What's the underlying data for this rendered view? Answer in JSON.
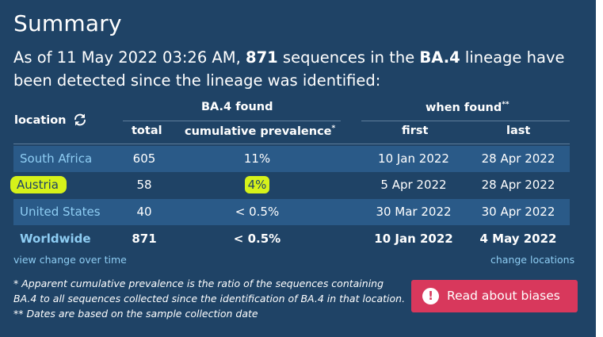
{
  "summary": {
    "title": "Summary",
    "intro_prefix": "As of 11 May 2022 03:26 AM, ",
    "sequence_count": "871",
    "intro_middle": " sequences in the ",
    "lineage": "BA.4",
    "intro_suffix": " lineage have been detected since the lineage was identified:"
  },
  "table": {
    "location_header": "location",
    "group_found": "BA.4 found",
    "group_when": "when found",
    "group_when_mark": "**",
    "col_total": "total",
    "col_prevalence": "cumulative prevalence",
    "col_prevalence_mark": "*",
    "col_first": "first",
    "col_last": "last",
    "rows": [
      {
        "location": "South Africa",
        "total": "605",
        "prevalence": "11%",
        "first": "10 Jan 2022",
        "last": "28 Apr 2022"
      },
      {
        "location": "Austria",
        "total": "58",
        "prevalence": "4%",
        "first": "5 Apr 2022",
        "last": "28 Apr 2022"
      },
      {
        "location": "United States",
        "total": "40",
        "prevalence": "< 0.5%",
        "first": "30 Mar 2022",
        "last": "30 Apr 2022"
      },
      {
        "location": "Worldwide",
        "total": "871",
        "prevalence": "< 0.5%",
        "first": "10 Jan 2022",
        "last": "4 May 2022"
      }
    ]
  },
  "links": {
    "view_change": "view change over time",
    "change_locations": "change locations"
  },
  "footnote": {
    "text": "* Apparent cumulative prevalence is the ratio of the sequences containing BA.4 to all sequences collected since the identification of BA.4 in that location.  ** Dates are based on the sample collection date"
  },
  "button": {
    "label": "Read about biases",
    "icon": "exclamation-circle-icon"
  },
  "colors": {
    "panel_bg": "#1f4366",
    "row_stripe": "#2a5a88",
    "location_link": "#8ecdf3",
    "highlight": "#d6f21a",
    "button_bg": "#d8385c"
  }
}
